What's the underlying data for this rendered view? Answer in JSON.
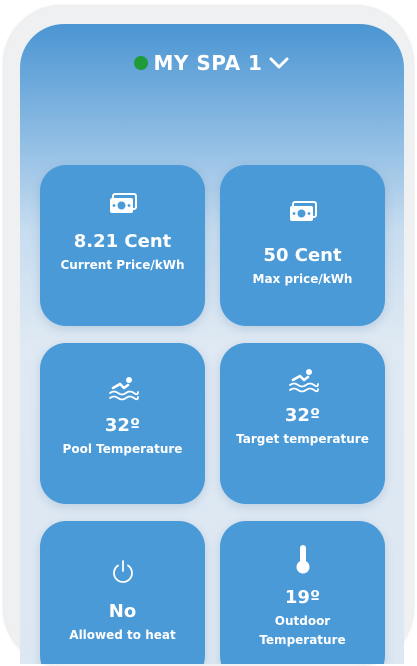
{
  "header": {
    "spa_name": "MY SPA 1",
    "status_color": "#1f9b3a"
  },
  "tiles": [
    {
      "icon": "money-icon",
      "value": "8.21 Cent",
      "label": "Current Price/kWh"
    },
    {
      "icon": "money-icon",
      "value": "50 Cent",
      "label": "Max price/kWh"
    },
    {
      "icon": "swimmer-icon",
      "value": "32º",
      "label": "Pool Temperature"
    },
    {
      "icon": "swimmer-icon",
      "value": "32º",
      "label": "Target temperature"
    },
    {
      "icon": "power-icon",
      "value": "No",
      "label": "Allowed to heat"
    },
    {
      "icon": "thermometer-icon",
      "value": "19º",
      "label": "Outdoor Temperature"
    }
  ],
  "colors": {
    "tile_bg": "#4a9ad8",
    "accent": "#4a95d2"
  }
}
